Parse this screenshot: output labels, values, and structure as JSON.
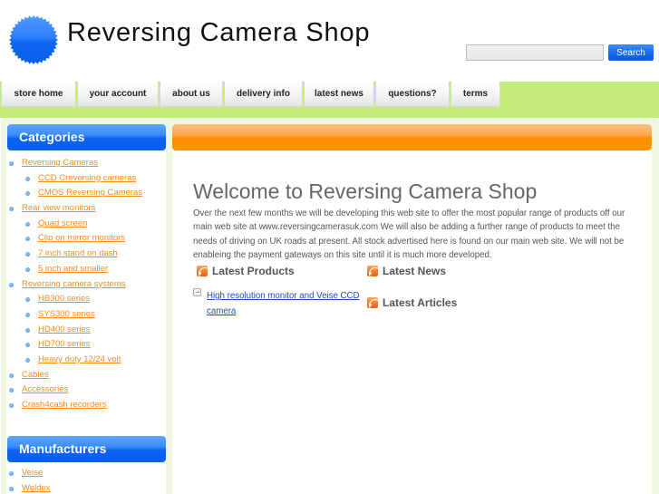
{
  "header": {
    "title": "Reversing Camera Shop",
    "logo_icon": "blue-starburst-logo",
    "search": {
      "placeholder": "",
      "value": "",
      "button_label": "Search"
    }
  },
  "nav": {
    "tabs": [
      {
        "label": "store home"
      },
      {
        "label": "your account"
      },
      {
        "label": "about us"
      },
      {
        "label": "delivery info"
      },
      {
        "label": "latest news"
      },
      {
        "label": "questions?"
      },
      {
        "label": "terms"
      }
    ]
  },
  "sidebar": {
    "categories_title": "Categories",
    "categories": [
      {
        "label": "Reversing Cameras",
        "level": 1
      },
      {
        "label": "CCD Creversing cameras",
        "level": 2
      },
      {
        "label": "CMOS Reversing Cameras",
        "level": 2
      },
      {
        "label": "Rear view monitors",
        "level": 1
      },
      {
        "label": "Quad screen",
        "level": 2
      },
      {
        "label": "Clip on mirror monitors",
        "level": 2
      },
      {
        "label": "7 inch stand on dash",
        "level": 2
      },
      {
        "label": "5 inch and smaller",
        "level": 2
      },
      {
        "label": "Reversing camera systems",
        "level": 1
      },
      {
        "label": "HB300 series",
        "level": 2
      },
      {
        "label": "SYS300 series",
        "level": 2
      },
      {
        "label": "HD400 series",
        "level": 2
      },
      {
        "label": "HD700 series",
        "level": 2
      },
      {
        "label": "Heavy duty 12/24 volt",
        "level": 2
      },
      {
        "label": "Cables",
        "level": 1
      },
      {
        "label": "Accessories",
        "level": 1
      },
      {
        "label": "Crash4cash recorders",
        "level": 1
      }
    ],
    "manufacturers_title": "Manufacturers",
    "manufacturers": [
      {
        "label": "Veise"
      },
      {
        "label": "Weldex"
      }
    ]
  },
  "main": {
    "welcome_title": "Welcome to Reversing Camera Shop",
    "welcome_text": "Over the next few months we will be developing this web site to offer the most popular range of products off our main web site at www.reversingcamerasuk.com We will also be adding a further range of products to meet the needs of driving on UK roads at present. All stock advertised here is found on our main web site. We will not be enableing the payment gateways on this site until it is much more developed.",
    "latest_products_title": "Latest Products",
    "latest_products": [
      {
        "label": "High resolution monitor and Veise CCD camera"
      }
    ],
    "latest_news_title": "Latest News",
    "latest_articles_title": "Latest Articles"
  },
  "colors": {
    "nav_green": "#c3ec7b",
    "content_bg": "#eef8df",
    "sidebar_header_blue": "#0b63ee",
    "main_header_orange": "#ff8f00",
    "link_orange": "#ff8a1a",
    "product_link_blue": "#1d4fb8"
  }
}
